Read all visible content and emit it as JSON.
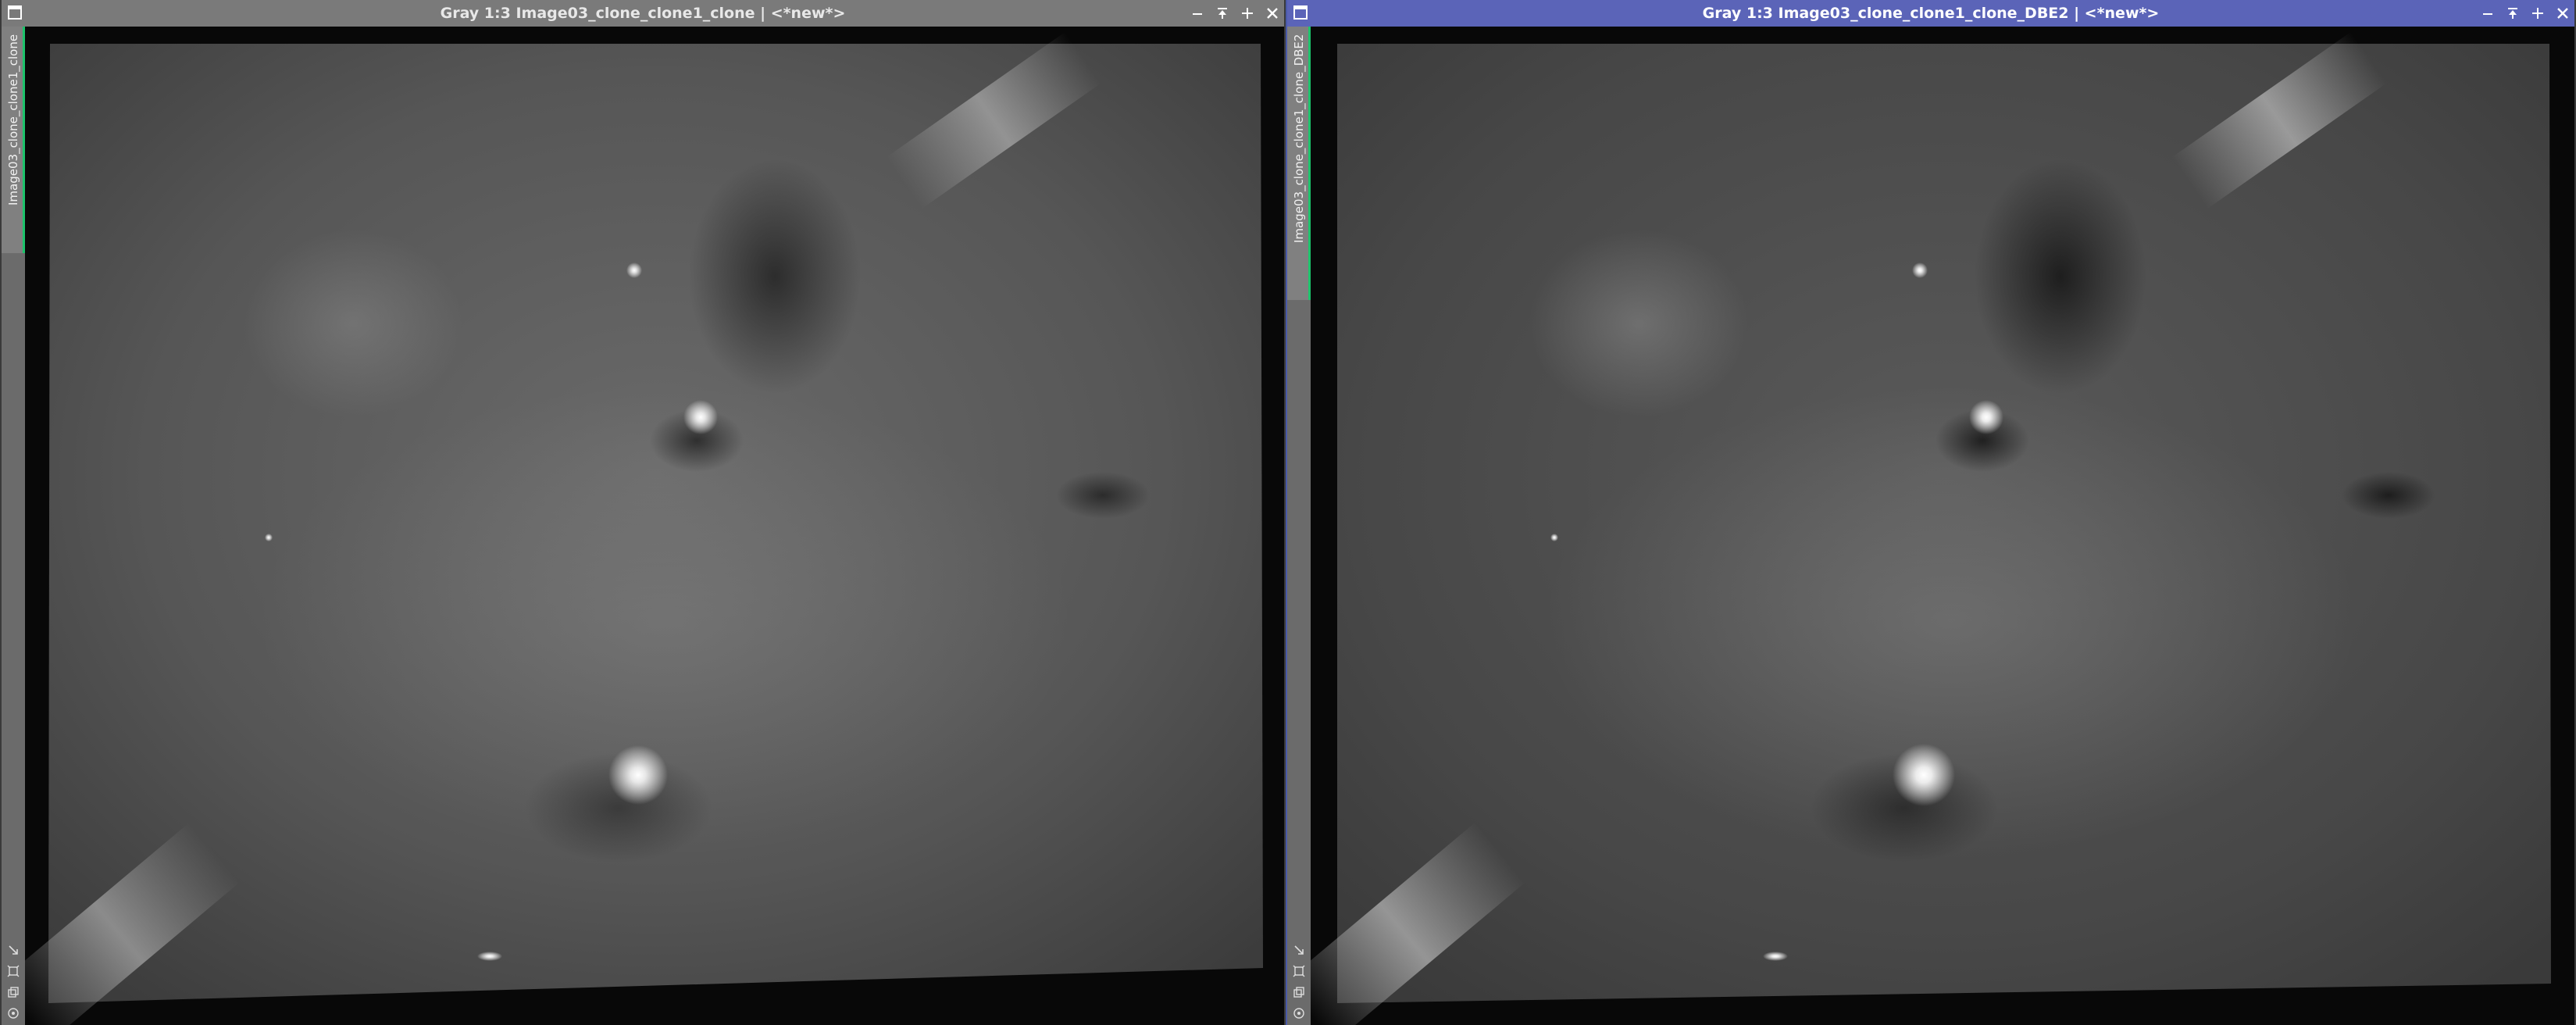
{
  "windows": [
    {
      "id": "left",
      "title": "Gray 1:3 Image03_clone_clone1_clone | <*new*>",
      "tab_label": "Image03_clone_clone1_clone",
      "active": false
    },
    {
      "id": "right",
      "title": "Gray 1:3 Image03_clone_clone1_clone_DBE2 | <*new*>",
      "tab_label": "Image03_clone_clone1_clone_DBE2",
      "active": true
    }
  ],
  "colors": {
    "active_titlebar": "#5b64b8",
    "inactive_titlebar": "#7a7a7a",
    "tab_accent": "#1cc46b"
  },
  "icons": {
    "window_controls": [
      "minimize-icon",
      "shade-icon",
      "maximize-icon",
      "close-icon"
    ],
    "side_tools": [
      "zoom-to-fit-icon",
      "fit-view-icon",
      "clone-view-icon",
      "options-icon"
    ]
  }
}
